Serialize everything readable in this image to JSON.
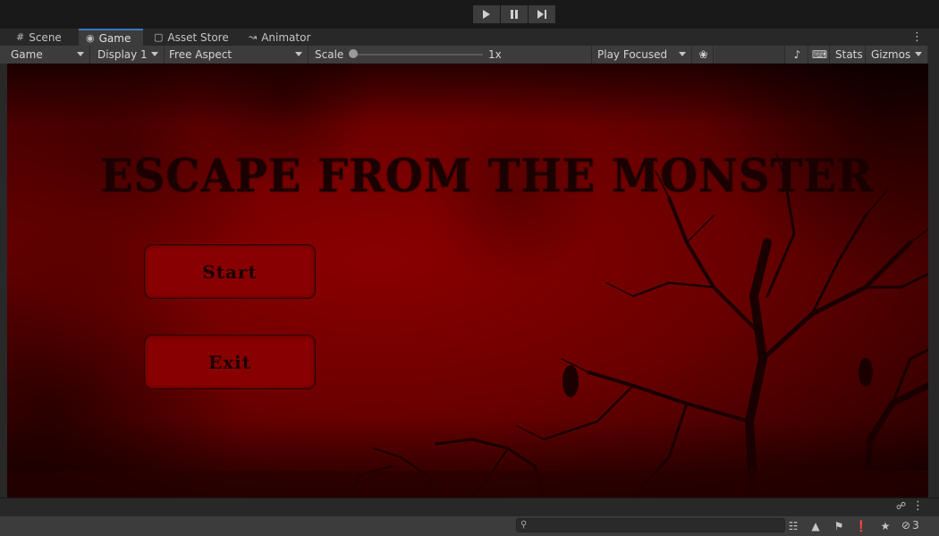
{
  "playbar": {
    "play": "play-icon",
    "pause": "pause-icon",
    "step": "step-icon"
  },
  "tabs": [
    {
      "label": "Scene",
      "icon": "grid-icon",
      "active": false
    },
    {
      "label": "Game",
      "icon": "gamepad-icon",
      "active": true
    },
    {
      "label": "Asset Store",
      "icon": "store-bag-icon",
      "active": false
    },
    {
      "label": "Animator",
      "icon": "animator-icon",
      "active": false
    }
  ],
  "toolbar": {
    "view_select": "Game",
    "display_select": "Display 1",
    "aspect_select": "Free Aspect",
    "scale_label": "Scale",
    "scale_value": "1x",
    "scale_level": 0.0,
    "play_mode": "Play Focused",
    "stats_label": "Stats",
    "gizmos_label": "Gizmos"
  },
  "game": {
    "title": "Escape From The Monster",
    "start_label": "Start",
    "exit_label": "Exit",
    "colors": {
      "background": "#7a0000",
      "button": "#880000",
      "text": "#1a0000"
    }
  },
  "status": {
    "hidden_count": "3"
  }
}
